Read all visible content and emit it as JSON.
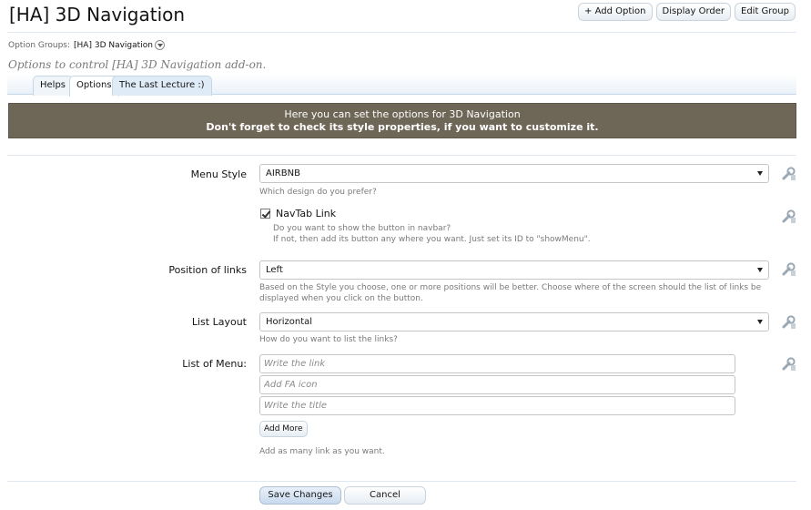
{
  "header": {
    "title": "[HA] 3D Navigation",
    "actions": {
      "add_option": "+ Add Option",
      "display_order": "Display Order",
      "edit_group": "Edit Group"
    }
  },
  "breadcrumb": {
    "label": "Option Groups:",
    "value": "[HA] 3D Navigation"
  },
  "description": "Options to control [HA] 3D Navigation add-on.",
  "tabs": [
    {
      "label": "Helps",
      "active": false
    },
    {
      "label": "Options",
      "active": true
    },
    {
      "label": "The Last Lecture :)",
      "active": false
    }
  ],
  "notice": {
    "line1": "Here you can set the options for 3D Navigation",
    "line2": "Don't forget to check its style properties, if you want to customize it."
  },
  "options": {
    "menu_style": {
      "label": "Menu Style",
      "value": "AIRBNB",
      "hint": "Which design do you prefer?"
    },
    "navtab_link": {
      "label": "NavTab Link",
      "checked": true,
      "hint1": "Do you want to show the button in navbar?",
      "hint2": "If not, then add its button any where you want.  Just set its ID to \"showMenu\"."
    },
    "position_of_links": {
      "label": "Position of links",
      "value": "Left",
      "hint1": "Based on the Style you choose, one or more positions will be better. Choose where of the screen should the list of links be",
      "hint2": "displayed when you click on the button."
    },
    "list_layout": {
      "label": "List Layout",
      "value": "Horizontal",
      "hint": "How do you want to list the links?"
    },
    "list_of_menu": {
      "label": "List of Menu:",
      "placeholder_link": "Write the link",
      "placeholder_icon": "Add FA icon",
      "placeholder_title": "Write the title",
      "add_more": "Add More",
      "hint": "Add as many link as you want."
    }
  },
  "footer": {
    "save": "Save Changes",
    "cancel": "Cancel"
  },
  "colors": {
    "notice_bg": "#6e6657",
    "accent": "#c5d7e6",
    "hint_text": "#7a7a7a"
  },
  "icons": {
    "edit": "wrench-icon",
    "dropdown": "chevron-down-icon"
  }
}
